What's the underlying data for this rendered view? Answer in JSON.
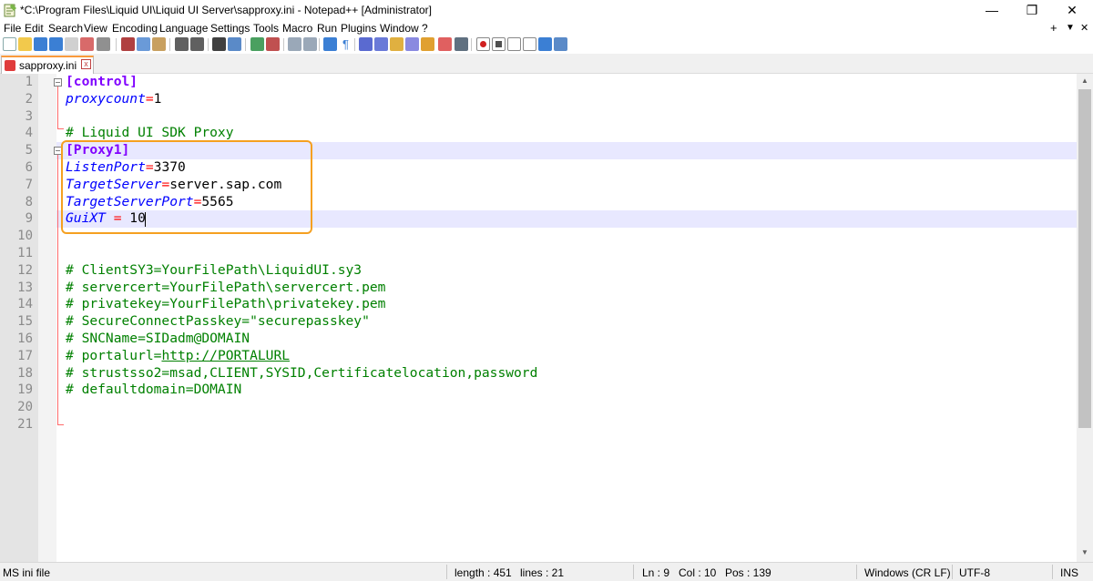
{
  "window": {
    "title": "*C:\\Program Files\\Liquid UI\\Liquid UI Server\\sapproxy.ini - Notepad++ [Administrator]",
    "minimize_glyph": "—",
    "maximize_glyph": "❐",
    "close_glyph": "✕"
  },
  "menu": {
    "items": [
      "File",
      "Edit",
      "Search",
      "View",
      "Encoding",
      "Language",
      "Settings",
      "Tools",
      "Macro",
      "Run",
      "Plugins",
      "Window",
      "?"
    ],
    "right_plus": "+",
    "right_down": "▼",
    "right_close": "✕"
  },
  "tab": {
    "label": "sapproxy.ini",
    "close_glyph": "x"
  },
  "editor": {
    "line_numbers": [
      "1",
      "2",
      "3",
      "4",
      "5",
      "6",
      "7",
      "8",
      "9",
      "10",
      "11",
      "12",
      "13",
      "14",
      "15",
      "16",
      "17",
      "18",
      "19",
      "20",
      "21"
    ],
    "lines": {
      "l1_section": "[control]",
      "l2_key": "proxycount",
      "l2_eq": "=",
      "l2_val": "1",
      "l4_comment": "# Liquid UI SDK Proxy",
      "l5_section": "[Proxy1]",
      "l6_key": "ListenPort",
      "l6_eq": "=",
      "l6_val": "3370",
      "l7_key": "TargetServer",
      "l7_eq": "=",
      "l7_val": "server.sap.com",
      "l8_key": "TargetServerPort",
      "l8_eq": "=",
      "l8_val": "5565",
      "l9_key": "GuiXT ",
      "l9_eq": "=",
      "l9_val": " 10",
      "l12_comment": "# ClientSY3=YourFilePath\\LiquidUI.sy3",
      "l13_comment": "# servercert=YourFilePath\\servercert.pem",
      "l14_comment": "# privatekey=YourFilePath\\privatekey.pem",
      "l15_comment": "# SecureConnectPasskey=\"securepasskey\"",
      "l16_comment": "# SNCName=SIDadm@DOMAIN",
      "l17_prefix": "# portalurl=",
      "l17_link": "http://PORTALURL",
      "l18_comment": "# strustsso2=msad,CLIENT,SYSID,Certificatelocation,password",
      "l19_comment": "# defaultdomain=DOMAIN"
    },
    "caret_line": 9,
    "caret_col": 10
  },
  "status": {
    "file_type": "MS ini file",
    "length": "length : 451",
    "lines": "lines : 21",
    "ln": "Ln : 9",
    "col": "Col : 10",
    "pos": "Pos : 139",
    "eol": "Windows (CR LF)",
    "encoding": "UTF-8",
    "mode": "INS"
  },
  "colors": {
    "section": "#8000ff",
    "key": "#0000ff",
    "operator": "#ff0000",
    "comment": "#008000",
    "highlight_box": "#f5a020",
    "current_line": "#e8e8ff"
  }
}
